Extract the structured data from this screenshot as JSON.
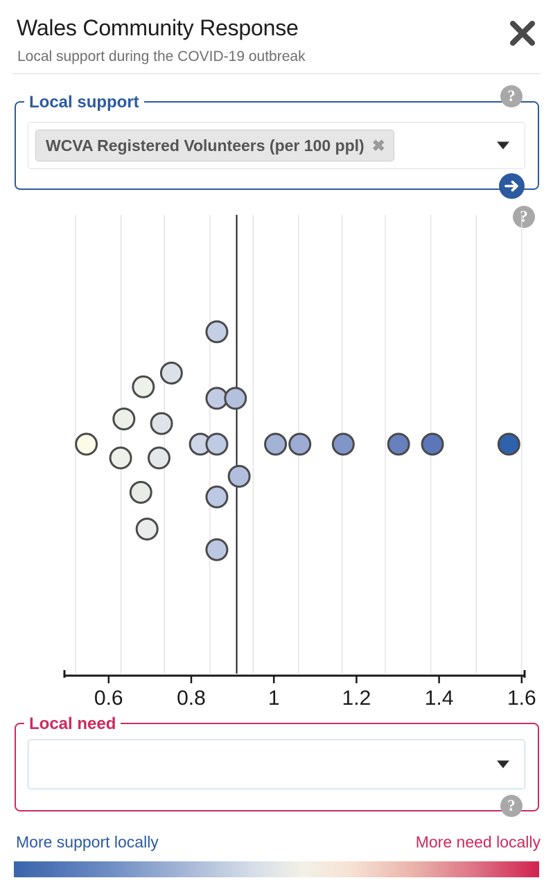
{
  "header": {
    "title": "Wales Community Response",
    "subtitle": "Local support during the COVID-19 outbreak",
    "close_icon": "close-icon"
  },
  "support_panel": {
    "legend": "Local support",
    "selected_token": "WCVA Registered Volunteers (per 100 ppl)",
    "token_remove_icon": "✖",
    "dropdown_caret_icon": "chevron-down-icon",
    "help_icon": "?",
    "go_icon": "arrow-right-icon"
  },
  "need_panel": {
    "legend": "Local need",
    "selected_token": "",
    "placeholder": "",
    "dropdown_caret_icon": "chevron-down-icon",
    "help_icon": "?"
  },
  "chart_help": {
    "help_icon": "?"
  },
  "color_scale": {
    "left_label": "More support locally",
    "right_label": "More need locally",
    "left_color": "#3a64ac",
    "mid_color": "#f5f2e6",
    "right_color": "#d1234f"
  },
  "chart_data": {
    "type": "scatter",
    "title": "",
    "xlabel": "",
    "ylabel": "",
    "xlim": [
      0.493,
      1.607
    ],
    "ylim": [
      0,
      1
    ],
    "grid": true,
    "legend": "none",
    "tick_values": [
      0.6,
      0.8,
      1.0,
      1.2,
      1.4,
      1.6
    ],
    "tick_labels": [
      "0.6",
      "0.8",
      "1",
      "1.2",
      "1.4",
      "1.6"
    ],
    "gridline_values": [
      0.52,
      0.63,
      0.735,
      0.845,
      0.95,
      1.06,
      1.165,
      1.27,
      1.38,
      1.49,
      1.6
    ],
    "reference_line": {
      "value": 0.91,
      "color": "#1a1a1a",
      "width": 2
    },
    "marker": {
      "radius": 15,
      "stroke": "#4a4a4a",
      "stroke_width": 3
    },
    "points": [
      {
        "x": 0.546,
        "y": 0.5,
        "color": "#fbfbe8"
      },
      {
        "x": 0.629,
        "y": 0.47,
        "color": "#eef0ea"
      },
      {
        "x": 0.637,
        "y": 0.555,
        "color": "#edefe9"
      },
      {
        "x": 0.684,
        "y": 0.625,
        "color": "#eef0ea"
      },
      {
        "x": 0.678,
        "y": 0.395,
        "color": "#e8ebe6"
      },
      {
        "x": 0.693,
        "y": 0.315,
        "color": "#e9ecea"
      },
      {
        "x": 0.722,
        "y": 0.47,
        "color": "#e4e8ea"
      },
      {
        "x": 0.728,
        "y": 0.545,
        "color": "#dfe4e9"
      },
      {
        "x": 0.752,
        "y": 0.655,
        "color": "#dce1e9"
      },
      {
        "x": 0.822,
        "y": 0.5,
        "color": "#cdd5e6"
      },
      {
        "x": 0.862,
        "y": 0.745,
        "color": "#c4cee4"
      },
      {
        "x": 0.862,
        "y": 0.6,
        "color": "#c1cbe3"
      },
      {
        "x": 0.862,
        "y": 0.5,
        "color": "#bfcae3"
      },
      {
        "x": 0.862,
        "y": 0.385,
        "color": "#bdc8e2"
      },
      {
        "x": 0.862,
        "y": 0.27,
        "color": "#bcc7e1"
      },
      {
        "x": 0.907,
        "y": 0.6,
        "color": "#b4c0de"
      },
      {
        "x": 0.916,
        "y": 0.43,
        "color": "#b2bedd"
      },
      {
        "x": 1.004,
        "y": 0.5,
        "color": "#a3b2d7"
      },
      {
        "x": 1.063,
        "y": 0.5,
        "color": "#9cacd4"
      },
      {
        "x": 1.168,
        "y": 0.5,
        "color": "#8096c9"
      },
      {
        "x": 1.302,
        "y": 0.5,
        "color": "#6880bd"
      },
      {
        "x": 1.384,
        "y": 0.5,
        "color": "#5b77b9"
      },
      {
        "x": 1.569,
        "y": 0.5,
        "color": "#2e62ad"
      }
    ]
  }
}
